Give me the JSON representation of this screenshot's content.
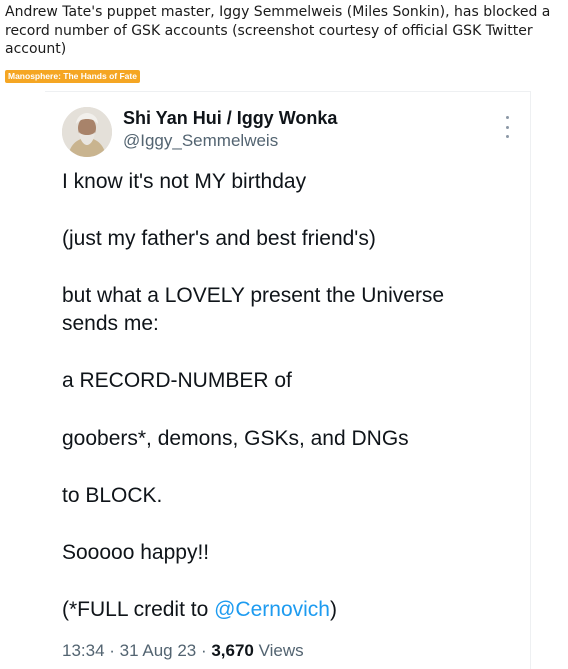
{
  "post": {
    "title": "Andrew Tate's puppet master, Iggy Semmelweis (Miles Sonkin), has blocked a record number of GSK accounts (screenshot courtesy of official GSK Twitter account)",
    "flair": "Manosphere: The Hands of Fate",
    "flair_color": "#f5a623"
  },
  "tweet": {
    "display_name": "Shi Yan Hui / Iggy Wonka",
    "handle": "@Iggy_Semmelweis",
    "more_icon": "vertical-ellipsis-icon",
    "lines": [
      "I know it's not MY birthday",
      "(just my father's and best friend's)",
      "but what a LOVELY present the Universe",
      "sends me:",
      "a RECORD-NUMBER of",
      "goobers*, demons, GSKs, and DNGs",
      "to BLOCK.",
      "Sooooo happy!!"
    ],
    "credit_prefix": "(*FULL credit to ",
    "credit_mention": "@Cernovich",
    "credit_suffix": ")",
    "time": "13:34",
    "separator": " · ",
    "date": "31 Aug 23",
    "views_count": "3,670",
    "views_label": " Views",
    "link_color": "#1d9bf0"
  }
}
